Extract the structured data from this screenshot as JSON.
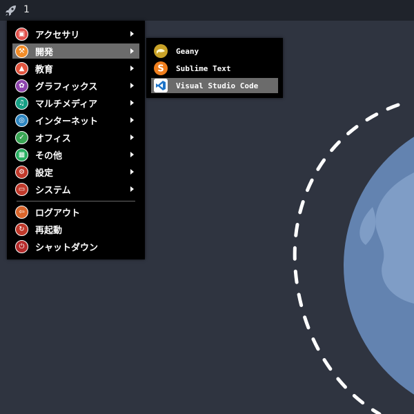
{
  "taskbar": {
    "workspace_number": "1",
    "launcher_icon": "rocket-icon"
  },
  "colors": {
    "background": "#2f3440",
    "taskbar": "#1f232b",
    "menu_bg": "#000000",
    "highlight": "#6b6b6b",
    "globe": "#6383b0",
    "globe_light": "#7f9dc6"
  },
  "menu": {
    "items": [
      {
        "label": "アクセサリ",
        "icon": "accessories-icon",
        "color": "#e0504b",
        "submenu": true
      },
      {
        "label": "開発",
        "icon": "development-icon",
        "color": "#f28c28",
        "submenu": true,
        "active": true
      },
      {
        "label": "教育",
        "icon": "education-icon",
        "color": "#e2553f",
        "submenu": true
      },
      {
        "label": "グラフィックス",
        "icon": "graphics-icon",
        "color": "#8e44ad",
        "submenu": true
      },
      {
        "label": "マルチメディア",
        "icon": "multimedia-icon",
        "color": "#16a085",
        "submenu": true
      },
      {
        "label": "インターネット",
        "icon": "internet-icon",
        "color": "#2e86c1",
        "submenu": true
      },
      {
        "label": "オフィス",
        "icon": "office-icon",
        "color": "#3aa655",
        "submenu": true
      },
      {
        "label": "その他",
        "icon": "other-icon",
        "color": "#27ae60",
        "submenu": true
      },
      {
        "label": "設定",
        "icon": "settings-icon",
        "color": "#c0392b",
        "submenu": true
      },
      {
        "label": "システム",
        "icon": "system-icon",
        "color": "#c0392b",
        "submenu": true
      }
    ],
    "session": [
      {
        "label": "ログアウト",
        "icon": "logout-icon",
        "color": "#d9652b"
      },
      {
        "label": "再起動",
        "icon": "reboot-icon",
        "color": "#c0392b"
      },
      {
        "label": "シャットダウン",
        "icon": "shutdown-icon",
        "color": "#b52b2b"
      }
    ]
  },
  "submenu": {
    "items": [
      {
        "label": "Geany",
        "icon": "geany-icon",
        "color": "#c9a227"
      },
      {
        "label": "Sublime Text",
        "icon": "sublime-text-icon",
        "color": "#f07e1c"
      },
      {
        "label": "Visual Studio Code",
        "icon": "vscode-icon",
        "color": "#1e74c8",
        "active": true
      }
    ]
  }
}
